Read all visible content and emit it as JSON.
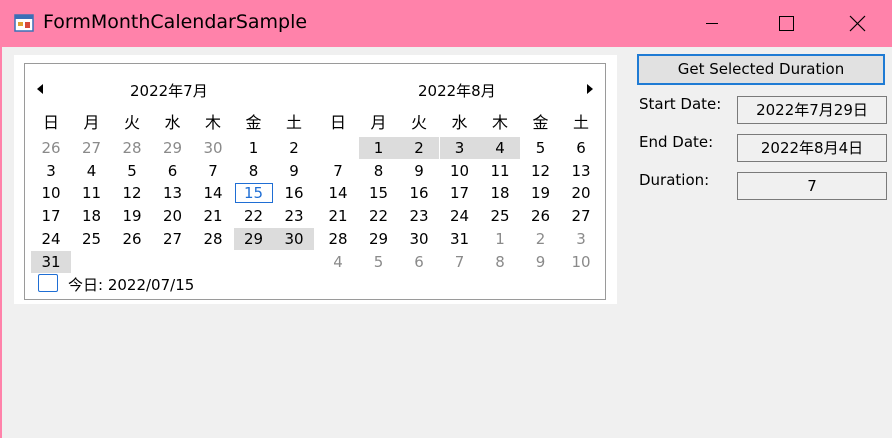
{
  "window": {
    "title": "FormMonthCalendarSample",
    "accent": "#ff82aa"
  },
  "calendar": {
    "month1_title": "2022年7月",
    "month2_title": "2022年8月",
    "weekdays": [
      "日",
      "月",
      "火",
      "水",
      "木",
      "金",
      "土"
    ],
    "month1_weeks": [
      [
        "26",
        "27",
        "28",
        "29",
        "30",
        "1",
        "2"
      ],
      [
        "3",
        "4",
        "5",
        "6",
        "7",
        "8",
        "9"
      ],
      [
        "10",
        "11",
        "12",
        "13",
        "14",
        "15",
        "16"
      ],
      [
        "17",
        "18",
        "19",
        "20",
        "21",
        "22",
        "23"
      ],
      [
        "24",
        "25",
        "26",
        "27",
        "28",
        "29",
        "30"
      ],
      [
        "31",
        "",
        "",
        "",
        "",
        "",
        ""
      ]
    ],
    "month2_weeks": [
      [
        "",
        "1",
        "2",
        "3",
        "4",
        "5",
        "6"
      ],
      [
        "7",
        "8",
        "9",
        "10",
        "11",
        "12",
        "13"
      ],
      [
        "14",
        "15",
        "16",
        "17",
        "18",
        "19",
        "20"
      ],
      [
        "21",
        "22",
        "23",
        "24",
        "25",
        "26",
        "27"
      ],
      [
        "28",
        "29",
        "30",
        "31",
        "1",
        "2",
        "3"
      ],
      [
        "4",
        "5",
        "6",
        "7",
        "8",
        "9",
        "10"
      ]
    ],
    "today_label": "今日: 2022/07/15",
    "selection_color": "#dcdcdc",
    "today_color": "#1f6ed4"
  },
  "panel": {
    "button_label": "Get Selected Duration",
    "start_label": "Start Date:",
    "start_value": "2022年7月29日",
    "end_label": "End Date:",
    "end_value": "2022年8月4日",
    "duration_label": "Duration:",
    "duration_value": "7"
  }
}
